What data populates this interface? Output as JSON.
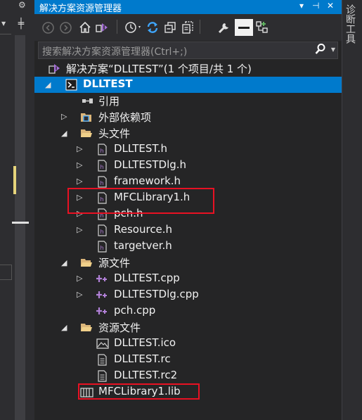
{
  "window": {
    "title": "解决方案资源管理器",
    "buttons": [
      "▾",
      "⊣",
      "✕"
    ]
  },
  "right_panel": {
    "label": "诊断工具"
  },
  "toolbar": {
    "icons": [
      "back-icon",
      "forward-icon",
      "home-icon",
      "vs-switch-icon",
      "history-icon",
      "sync-icon",
      "collapse-all-icon",
      "show-all-files-icon",
      "properties-wrench-icon",
      "preview-icon",
      "view-class-diagram-icon"
    ]
  },
  "search": {
    "placeholder": "搜索解决方案资源管理器(Ctrl+;)"
  },
  "tree": {
    "solution": "解决方案“DLLTEST”(1 个项目/共 1 个)",
    "project": "DLLTEST",
    "items": [
      {
        "label": "引用",
        "icon": "references-icon"
      },
      {
        "label": "外部依赖项",
        "icon": "external-deps-icon"
      },
      {
        "label": "头文件",
        "icon": "folder-icon"
      },
      {
        "label": "DLLTEST.h",
        "icon": "header-file-icon"
      },
      {
        "label": "DLLTESTDlg.h",
        "icon": "header-file-icon"
      },
      {
        "label": "framework.h",
        "icon": "header-file-icon"
      },
      {
        "label": "MFCLibrary1.h",
        "icon": "header-file-icon"
      },
      {
        "label": "pch.h",
        "icon": "header-file-icon"
      },
      {
        "label": "Resource.h",
        "icon": "header-file-icon"
      },
      {
        "label": "targetver.h",
        "icon": "header-file-icon"
      },
      {
        "label": "源文件",
        "icon": "folder-icon"
      },
      {
        "label": "DLLTEST.cpp",
        "icon": "cpp-file-icon"
      },
      {
        "label": "DLLTESTDlg.cpp",
        "icon": "cpp-file-icon"
      },
      {
        "label": "pch.cpp",
        "icon": "cpp-file-icon"
      },
      {
        "label": "资源文件",
        "icon": "folder-icon"
      },
      {
        "label": "DLLTEST.ico",
        "icon": "image-file-icon"
      },
      {
        "label": "DLLTEST.rc",
        "icon": "rc-file-icon"
      },
      {
        "label": "DLLTEST.rc2",
        "icon": "rc-file-icon"
      },
      {
        "label": "MFCLibrary1.lib",
        "icon": "lib-file-icon"
      }
    ]
  },
  "colors": {
    "accent": "#007acc",
    "highlight_box": "#e81123",
    "background": "#252526"
  }
}
